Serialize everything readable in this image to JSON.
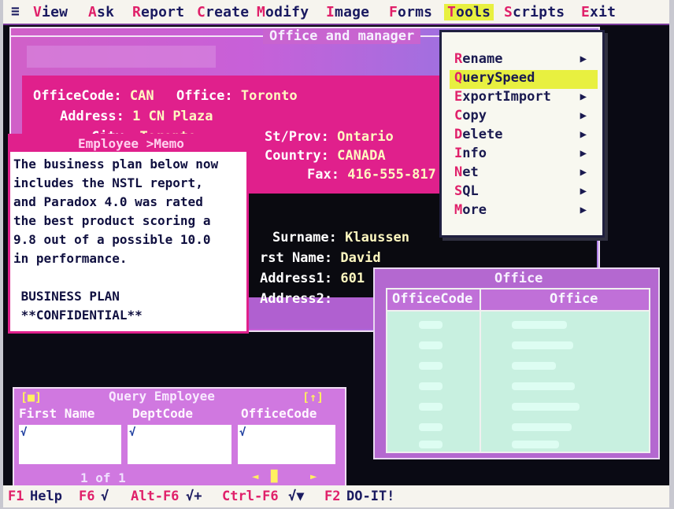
{
  "menubar": {
    "system_glyph": "≡",
    "items": [
      {
        "hot": "V",
        "rest": "iew"
      },
      {
        "hot": "A",
        "rest": "sk"
      },
      {
        "hot": "R",
        "rest": "eport"
      },
      {
        "hot": "C",
        "rest": "reate"
      },
      {
        "hot": "M",
        "rest": "odify"
      },
      {
        "hot": "I",
        "rest": "mage"
      },
      {
        "hot": "F",
        "rest": "orms"
      },
      {
        "hot": "T",
        "rest": "ools"
      },
      {
        "hot": "S",
        "rest": "cripts"
      },
      {
        "hot": "E",
        "rest": "xit"
      }
    ]
  },
  "office_window": {
    "title": "Office and manager",
    "fields": {
      "officecode_label": "OfficeCode:",
      "officecode_value": "CAN",
      "office_label": "Office:",
      "office_value": "Toronto",
      "address_label": "Address:",
      "address_value": "1 CN Plaza",
      "city_label": "City:",
      "city_value": "Toronto",
      "stprov_label": "St/Prov:",
      "stprov_value": "Ontario",
      "country_label": "Country:",
      "country_value": "CANADA",
      "fax_label": "Fax:",
      "fax_value": "416-555-817",
      "surname_label": "Surname:",
      "surname_value": "Klaussen",
      "firstname_label": "rst Name:",
      "firstname_value": "David",
      "address1_label": "Address1:",
      "address1_value": "601",
      "address2_label": "Address2:"
    }
  },
  "memo_window": {
    "title": "Employee >Memo",
    "lines": [
      "The business plan below now",
      "includes the NSTL report,",
      "and Paradox 4.0 was rated",
      "the best product scoring a",
      "9.8 out of a possible 10.0",
      "in performance.",
      "",
      " BUSINESS PLAN",
      " **CONFIDENTIAL**"
    ]
  },
  "office_table": {
    "title": "Office",
    "columns": [
      "OfficeCode",
      "Office"
    ]
  },
  "query_window": {
    "title": "Query Employee",
    "left_control": "[■]",
    "right_control": "[↑]",
    "columns": [
      "First Name",
      "DeptCode",
      "OfficeCode"
    ],
    "check_mark": "√",
    "record_position": "1 of 1"
  },
  "tools_menu": {
    "items": [
      {
        "hot": "R",
        "rest": "ename",
        "submenu": true
      },
      {
        "hot": "Q",
        "rest": "uerySpeed",
        "submenu": false,
        "selected": true
      },
      {
        "hot": "E",
        "rest": "xportImport",
        "submenu": true
      },
      {
        "hot": "C",
        "rest": "opy",
        "submenu": true
      },
      {
        "hot": "D",
        "rest": "elete",
        "submenu": true
      },
      {
        "hot": "I",
        "rest": "nfo",
        "submenu": true
      },
      {
        "hot": "N",
        "rest": "et",
        "submenu": true
      },
      {
        "hot": "S",
        "rest": "QL",
        "submenu": true
      },
      {
        "hot": "M",
        "rest": "ore",
        "submenu": true
      }
    ],
    "arrow_glyph": "▶"
  },
  "statusbar": {
    "items": [
      {
        "key": "F1",
        "text": "Help"
      },
      {
        "key": "F6",
        "text": "√"
      },
      {
        "key": "Alt-F6",
        "text": "√+"
      },
      {
        "key": "Ctrl-F6",
        "text": "√▼"
      },
      {
        "key": "F2",
        "text": "DO-IT!"
      }
    ]
  },
  "colors": {
    "accent_magenta": "#e0208c",
    "highlight_yellow": "#e8f040",
    "window_purple": "#c060d8",
    "table_mint": "#c8f0e0"
  }
}
